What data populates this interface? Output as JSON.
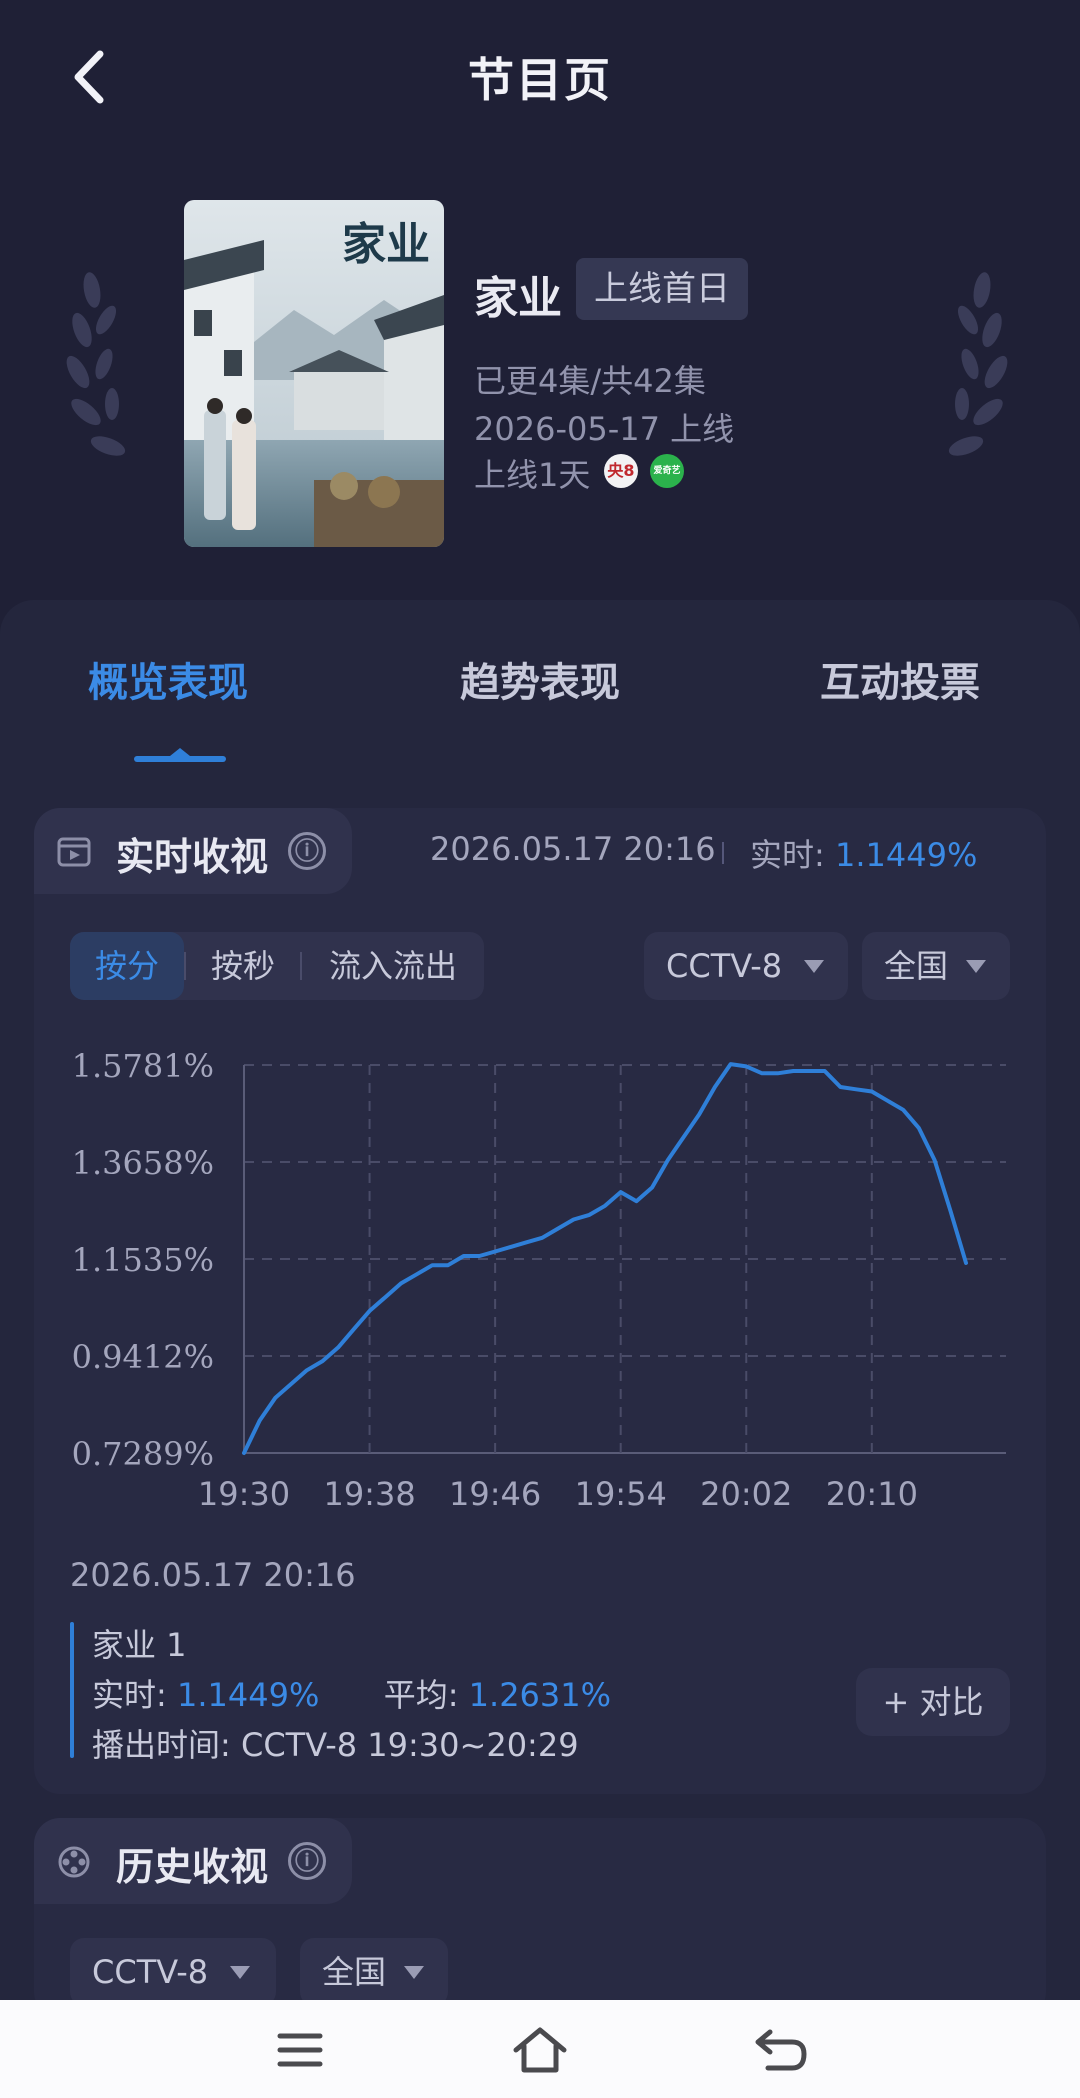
{
  "header": {
    "title": "节目页",
    "back_icon": "chevron-left-icon"
  },
  "show": {
    "poster_title": "家业",
    "name": "家业",
    "badge": "上线首日",
    "episodes": "已更4集/共42集",
    "premiere": "2026-05-17 上线",
    "days_online": "上线1天",
    "channel_logos": [
      "cctv8-logo",
      "iqiyi-logo"
    ],
    "cctv8_logo_text": "央8",
    "iqiyi_logo_text": "爱奇艺"
  },
  "tabs": [
    {
      "label": "概览表现",
      "active": true
    },
    {
      "label": "趋势表现",
      "active": false
    },
    {
      "label": "互动投票",
      "active": false
    }
  ],
  "realtime_card": {
    "title": "实时收视",
    "info_icon": "ⓘ",
    "timestamp": "2026.05.17 20:16",
    "realtime_label": "实时: ",
    "realtime_value": "1.1449%",
    "segments": [
      "按分",
      "按秒",
      "流入流出"
    ],
    "active_segment": "按分",
    "channel_select": "CCTV-8",
    "region_select": "全国"
  },
  "chart_data": {
    "type": "line",
    "title": "",
    "xlabel": "",
    "ylabel": "",
    "x_ticks": [
      "19:30",
      "19:38",
      "19:46",
      "19:54",
      "20:02",
      "20:10"
    ],
    "y_ticks": [
      "1.5781%",
      "1.3658%",
      "1.1535%",
      "0.9412%",
      "0.7289%"
    ],
    "ylim": [
      0.7289,
      1.5781
    ],
    "xlim_minutes": [
      0,
      46
    ],
    "grid": true,
    "color": "#2f7fd8",
    "series": [
      {
        "x": [
          "19:30",
          "19:31",
          "19:32",
          "19:33",
          "19:34",
          "19:35",
          "19:36",
          "19:37",
          "19:38",
          "19:39",
          "19:40",
          "19:41",
          "19:42",
          "19:43",
          "19:44",
          "19:45",
          "19:46",
          "19:47",
          "19:48",
          "19:49",
          "19:50",
          "19:51",
          "19:52",
          "19:53",
          "19:54",
          "19:55",
          "19:56",
          "19:57",
          "19:58",
          "19:59",
          "20:00",
          "20:01",
          "20:02",
          "20:03",
          "20:04",
          "20:05",
          "20:06",
          "20:07",
          "20:08",
          "20:09",
          "20:10",
          "20:11",
          "20:12",
          "20:13",
          "20:14",
          "20:15",
          "20:16"
        ],
        "values": [
          0.7289,
          0.8,
          0.85,
          0.88,
          0.91,
          0.93,
          0.96,
          1.0,
          1.04,
          1.07,
          1.1,
          1.12,
          1.14,
          1.14,
          1.16,
          1.16,
          1.17,
          1.18,
          1.19,
          1.2,
          1.22,
          1.24,
          1.25,
          1.27,
          1.3,
          1.28,
          1.31,
          1.37,
          1.42,
          1.47,
          1.53,
          1.58,
          1.575,
          1.56,
          1.56,
          1.565,
          1.565,
          1.565,
          1.53,
          1.525,
          1.52,
          1.5,
          1.48,
          1.44,
          1.37,
          1.26,
          1.1449
        ]
      }
    ]
  },
  "tooltip": {
    "date": "2026.05.17 20:16",
    "series_name": "家业 1",
    "realtime_label": "实时: ",
    "realtime_value": "1.1449%",
    "average_label": "平均: ",
    "average_value": "1.2631%",
    "airtime_label": "播出时间: ",
    "airtime_value": "CCTV-8 19:30~20:29",
    "compare_button": "+ 对比"
  },
  "history_card": {
    "title": "历史收视",
    "info_icon": "ⓘ",
    "channel_select": "CCTV-8",
    "region_select": "全国"
  },
  "bottom_nav": [
    "menu-icon",
    "home-icon",
    "back-icon"
  ]
}
